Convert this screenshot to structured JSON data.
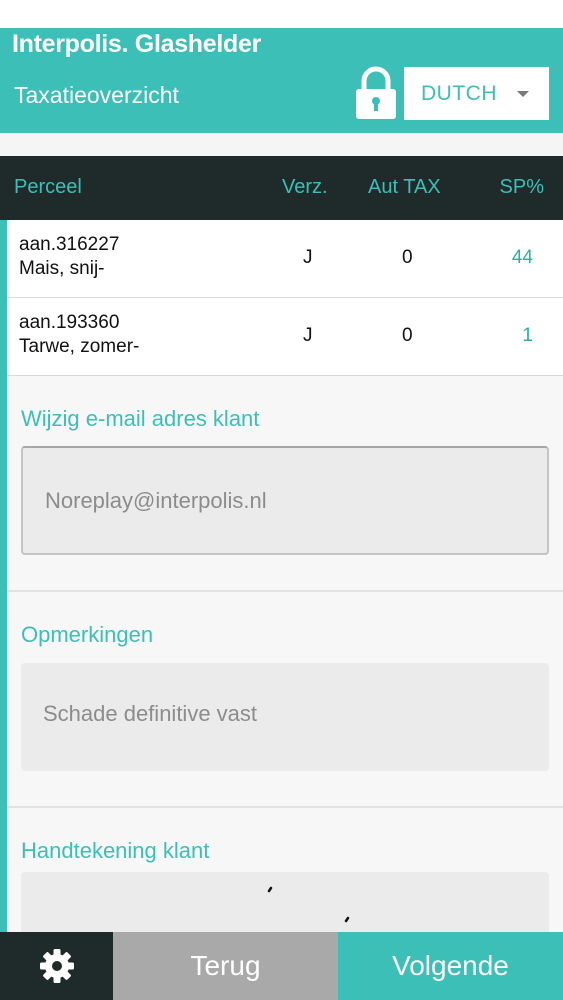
{
  "header": {
    "app_title": "Interpolis. Glashelder",
    "subtitle": "Taxatieoverzicht",
    "language": "DUTCH",
    "lock_icon": "lock-icon"
  },
  "table": {
    "columns": [
      "Perceel",
      "Verz.",
      "Aut TAX",
      "SP%"
    ],
    "rows": [
      {
        "code": "aan.316227",
        "crop": "Mais, snij-",
        "verz": "J",
        "aut_tax": "0",
        "sp": "44"
      },
      {
        "code": "aan.193360",
        "crop": "Tarwe, zomer-",
        "verz": "J",
        "aut_tax": "0",
        "sp": "1"
      }
    ]
  },
  "email_section": {
    "label": "Wijzig e-mail adres klant",
    "value": "Noreplay@interpolis.nl"
  },
  "remarks_section": {
    "label": "Opmerkingen",
    "value": "Schade definitive vast"
  },
  "signature_section": {
    "label": "Handtekening klant"
  },
  "footer": {
    "settings_icon": "gear-icon",
    "back_label": "Terug",
    "next_label": "Volgende"
  },
  "colors": {
    "accent": "#3cbfb7",
    "dark": "#1f2a2b",
    "back_button": "#a9a9a9"
  }
}
